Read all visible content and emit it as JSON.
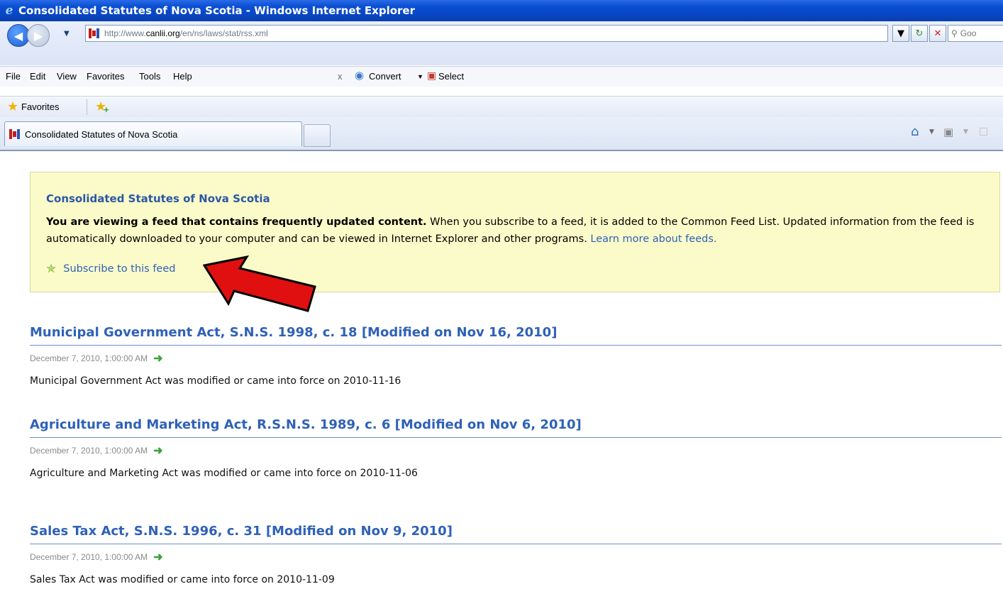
{
  "window": {
    "title": "Consolidated Statutes of Nova Scotia - Windows Internet Explorer"
  },
  "address": {
    "url_prefix": "http://www.",
    "url_domain": "canlii.org",
    "url_path": "/en/ns/laws/stat/rss.xml",
    "search_placeholder": "Goo"
  },
  "menu": [
    "File",
    "Edit",
    "View",
    "Favorites",
    "Tools",
    "Help"
  ],
  "commandbar": {
    "close": "x",
    "convert": "Convert",
    "select": "Select"
  },
  "favorites_bar": {
    "label": "Favorites"
  },
  "tab": {
    "label": "Consolidated Statutes of Nova Scotia"
  },
  "feed": {
    "title": "Consolidated Statutes of Nova Scotia",
    "intro_bold": "You are viewing a feed that contains frequently updated content.",
    "intro_text": " When you subscribe to a feed, it is added to the Common Feed List. Updated information from the feed is automatically downloaded to your computer and can be viewed in Internet Explorer and other programs. ",
    "learn_more": "Learn more about feeds.",
    "subscribe": "Subscribe to this feed"
  },
  "items": [
    {
      "title": "Municipal Government Act, S.N.S. 1998, c. 18 [Modified on Nov 16, 2010]",
      "date": "December 7, 2010, 1:00:00 AM",
      "body": "Municipal Government Act was modified or came into force on 2010-11-16"
    },
    {
      "title": "Agriculture and Marketing Act, R.S.N.S. 1989, c. 6 [Modified on Nov 6, 2010]",
      "date": "December 7, 2010, 1:00:00 AM",
      "body": "Agriculture and Marketing Act was modified or came into force on 2010-11-06"
    },
    {
      "title": "Sales Tax Act, S.N.S. 1996, c. 31 [Modified on Nov 9, 2010]",
      "date": "December 7, 2010, 1:00:00 AM",
      "body": "Sales Tax Act was modified or came into force on 2010-11-09"
    }
  ]
}
